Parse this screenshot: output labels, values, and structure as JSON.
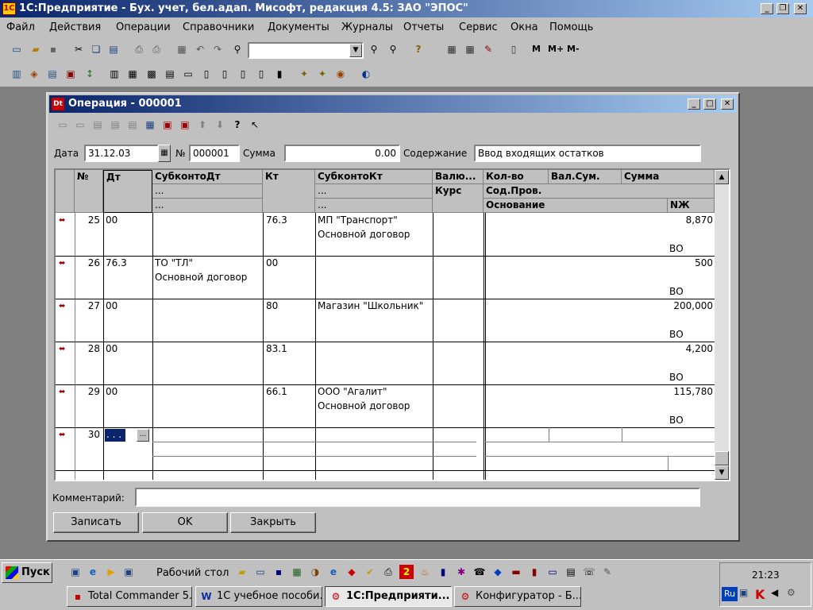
{
  "app": {
    "title": "1С:Предприятие - Бух. учет, бел.адап. Мисофт, редакция 4.5: ЗАО \"ЭПОС\"",
    "icon": "1c-logo-icon"
  },
  "menu": [
    "Файл",
    "Действия",
    "Операции",
    "Справочники",
    "Документы",
    "Журналы",
    "Отчеты",
    "Сервис",
    "Окна",
    "Помощь"
  ],
  "toolbar": {
    "memory_buttons": [
      "M",
      "M+",
      "M-"
    ],
    "search_value": ""
  },
  "dialog": {
    "title": "Операция - 000001",
    "date_label": "Дата",
    "date_value": "31.12.03",
    "number_label": "№",
    "number_value": "000001",
    "sum_label": "Сумма",
    "sum_value": "0.00",
    "content_label": "Содержание",
    "content_value": "Ввод входящих остатков",
    "comment_label": "Комментарий:",
    "comment_value": "",
    "buttons": {
      "save": "Записать",
      "ok": "OK",
      "close": "Закрыть"
    }
  },
  "table": {
    "headers": {
      "num": "№",
      "dt": "Дт",
      "subdt": "СубконтоДт",
      "subdt_sub1": "...",
      "subdt_sub2": "...",
      "kt": "Кт",
      "subkt": "СубконтоКт",
      "subkt_sub1": "...",
      "subkt_sub2": "...",
      "cur": "Валю...",
      "rate": "Курс",
      "qty": "Кол-во",
      "cursum": "Вал.Сум.",
      "sum": "Сумма",
      "content": "Сод.Пров.",
      "basis": "Основание",
      "journal": "NЖ"
    },
    "rows": [
      {
        "num": "25",
        "dt": "00",
        "subdt1": "",
        "subdt2": "",
        "kt": "76.3",
        "subkt1": "МП \"Транспорт\"",
        "subkt2": "Основной договор",
        "sum": "8,870",
        "nzh": "ВО"
      },
      {
        "num": "26",
        "dt": "76.3",
        "subdt1": "ТО \"ТЛ\"",
        "subdt2": "Основной договор",
        "kt": "00",
        "subkt1": "",
        "subkt2": "",
        "sum": "500",
        "nzh": "ВО"
      },
      {
        "num": "27",
        "dt": "00",
        "subdt1": "",
        "subdt2": "",
        "kt": "80",
        "subkt1": "Магазин \"Школьник\"",
        "subkt2": "",
        "sum": "200,000",
        "nzh": "ВО"
      },
      {
        "num": "28",
        "dt": "00",
        "subdt1": "",
        "subdt2": "",
        "kt": "83.1",
        "subkt1": "",
        "subkt2": "",
        "sum": "4,200",
        "nzh": "ВО"
      },
      {
        "num": "29",
        "dt": "00",
        "subdt1": "",
        "subdt2": "",
        "kt": "66.1",
        "subkt1": "ООО \"Агалит\"",
        "subkt2": "Основной договор",
        "sum": "115,780",
        "nzh": "ВО"
      }
    ],
    "edit_row": {
      "num": "30",
      "dt": ". . ."
    }
  },
  "taskbar": {
    "start": "Пуск",
    "desktop": "Рабочий стол",
    "clock": "21:23",
    "lang": "Ru",
    "tasks": [
      "Total Commander 5...",
      "1С учебное пособи...",
      "1С:Предприяти...",
      "Конфигуратор - Б..."
    ]
  }
}
